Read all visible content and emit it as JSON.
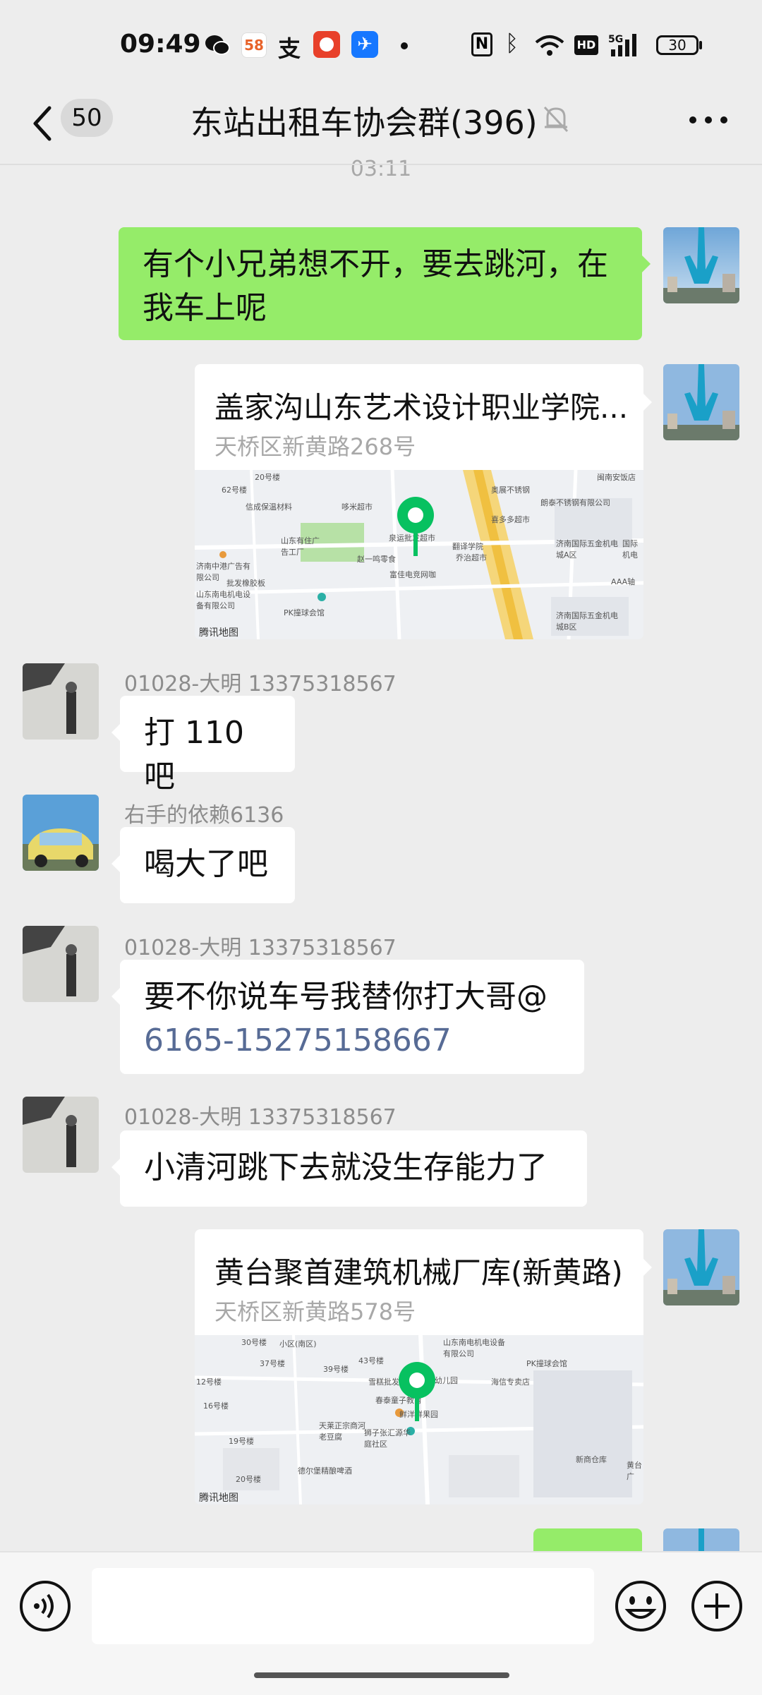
{
  "status_bar": {
    "time": "09:49",
    "app_58": "58",
    "battery": "30"
  },
  "header": {
    "unread_count": "50",
    "title": "东站出租车协会群(396)"
  },
  "timestamp": "03:11",
  "messages": [
    {
      "type": "text",
      "side": "right",
      "text_line1": "有个小兄弟想不开，要去跳河，在",
      "text_line2": "我车上呢"
    },
    {
      "type": "location",
      "side": "right",
      "title": "盖家沟山东艺术设计职业学院...",
      "address": "天桥区新黄路268号",
      "provider": "腾讯地图",
      "map_labels": [
        "20号楼",
        "62号楼",
        "信成保温材料",
        "哆米超市",
        "奥展不锈钢",
        "朗泰不锈钢有限公司",
        "喜多多超市",
        "泉运批发超市",
        "翻译学院",
        "乔治超市",
        "济南国际五金机电城A区",
        "山东有住广告工厂",
        "赵一鸣零食",
        "富佳电竞网咖",
        "济南中港广告有限公司",
        "批发橡胶板",
        "山东南电机电设备有限公司",
        "PK撞球会馆",
        "AAA轴",
        "济南国际五金机电城B区",
        "闽南安饭店",
        "国际机电"
      ]
    },
    {
      "type": "text",
      "side": "left",
      "sender": "01028-大明 13375318567",
      "text": "打 110 吧"
    },
    {
      "type": "text",
      "side": "left",
      "sender": "右手的依赖6136",
      "text": "喝大了吧"
    },
    {
      "type": "text",
      "side": "left",
      "sender": "01028-大明 13375318567",
      "text_line1": "要不你说车号我替你打大哥@",
      "link": "6165-15275158667"
    },
    {
      "type": "text",
      "side": "left",
      "sender": "01028-大明 13375318567",
      "text": "小清河跳下去就没生存能力了"
    },
    {
      "type": "location",
      "side": "right",
      "title": "黄台聚首建筑机械厂库(新黄路)",
      "address": "天桥区新黄路578号",
      "provider": "腾讯地图",
      "map_labels": [
        "30号楼",
        "小区(南区)",
        "37号楼",
        "39号楼",
        "43号楼",
        "山东南电机电设备有限公司",
        "PK撞球会馆",
        "海信专卖店",
        "12号楼",
        "16号楼",
        "19号楼",
        "20号楼",
        "雪糕批发",
        "幼儿园",
        "春泰童子教育",
        "鲜洋鲜果园",
        "天莱正宗商河老豆腐",
        "狮子张汇源华庭社区",
        "德尔堡精酿啤酒",
        "新商仓库",
        "黄台广"
      ]
    }
  ],
  "colors": {
    "sent_bubble": "#95ec69",
    "background": "#ededed",
    "pin": "#07c160",
    "link": "#576b95"
  },
  "icons": [
    "wechat-icon",
    "alipay-icon",
    "bluetooth-icon",
    "wifi-icon",
    "nfc-icon",
    "mute-bell-icon",
    "more-icon",
    "voice-icon",
    "emoji-icon",
    "plus-icon",
    "back-icon"
  ]
}
